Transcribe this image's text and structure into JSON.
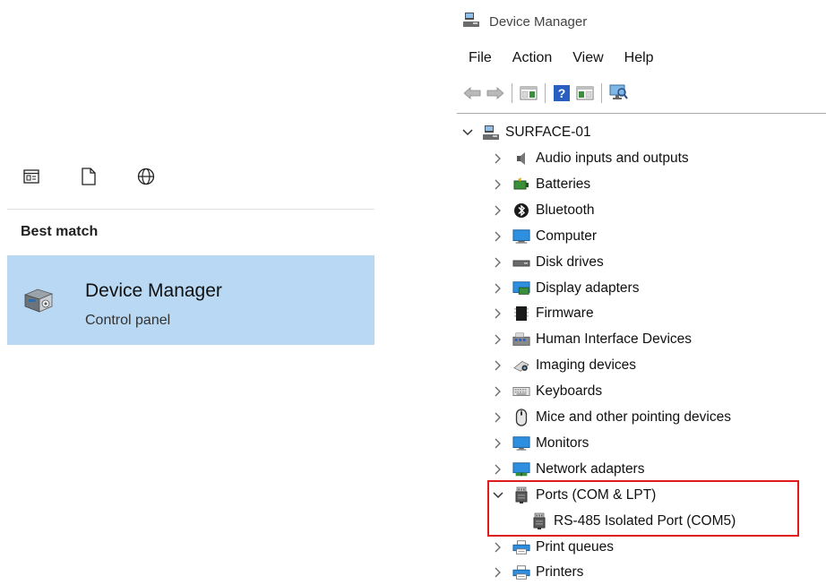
{
  "search": {
    "filter_icons": [
      "app-window-icon",
      "document-icon",
      "web-globe-icon"
    ],
    "section_heading": "Best match",
    "best_match": {
      "title": "Device Manager",
      "subtitle": "Control panel",
      "icon": "device-manager-icon"
    },
    "accent_color": "#b8d8f3"
  },
  "window": {
    "title": "Device Manager",
    "menu": [
      "File",
      "Action",
      "View",
      "Help"
    ],
    "toolbar_icons": [
      "back-arrow-icon",
      "forward-arrow-icon",
      "properties-icon",
      "help-icon",
      "update-driver-icon",
      "scan-hardware-icon"
    ]
  },
  "tree": {
    "root": "SURFACE-01",
    "items": [
      {
        "label": "Audio inputs and outputs",
        "icon": "speaker-icon",
        "expanded": false
      },
      {
        "label": "Batteries",
        "icon": "battery-icon",
        "expanded": false
      },
      {
        "label": "Bluetooth",
        "icon": "bluetooth-icon",
        "expanded": false
      },
      {
        "label": "Computer",
        "icon": "computer-icon",
        "expanded": false
      },
      {
        "label": "Disk drives",
        "icon": "disk-drive-icon",
        "expanded": false
      },
      {
        "label": "Display adapters",
        "icon": "display-adapter-icon",
        "expanded": false
      },
      {
        "label": "Firmware",
        "icon": "firmware-icon",
        "expanded": false
      },
      {
        "label": "Human Interface Devices",
        "icon": "hid-icon",
        "expanded": false
      },
      {
        "label": "Imaging devices",
        "icon": "camera-icon",
        "expanded": false
      },
      {
        "label": "Keyboards",
        "icon": "keyboard-icon",
        "expanded": false
      },
      {
        "label": "Mice and other pointing devices",
        "icon": "mouse-icon",
        "expanded": false
      },
      {
        "label": "Monitors",
        "icon": "monitor-icon",
        "expanded": false
      },
      {
        "label": "Network adapters",
        "icon": "network-adapter-icon",
        "expanded": false
      },
      {
        "label": "Ports (COM & LPT)",
        "icon": "port-icon",
        "expanded": true
      },
      {
        "label": "RS-485 Isolated Port (COM5)",
        "icon": "port-icon",
        "child": true
      },
      {
        "label": "Print queues",
        "icon": "printer-icon",
        "expanded": false
      },
      {
        "label": "Printers",
        "icon": "printer-icon",
        "expanded": false
      }
    ],
    "highlight_color": "#e01b1b"
  }
}
